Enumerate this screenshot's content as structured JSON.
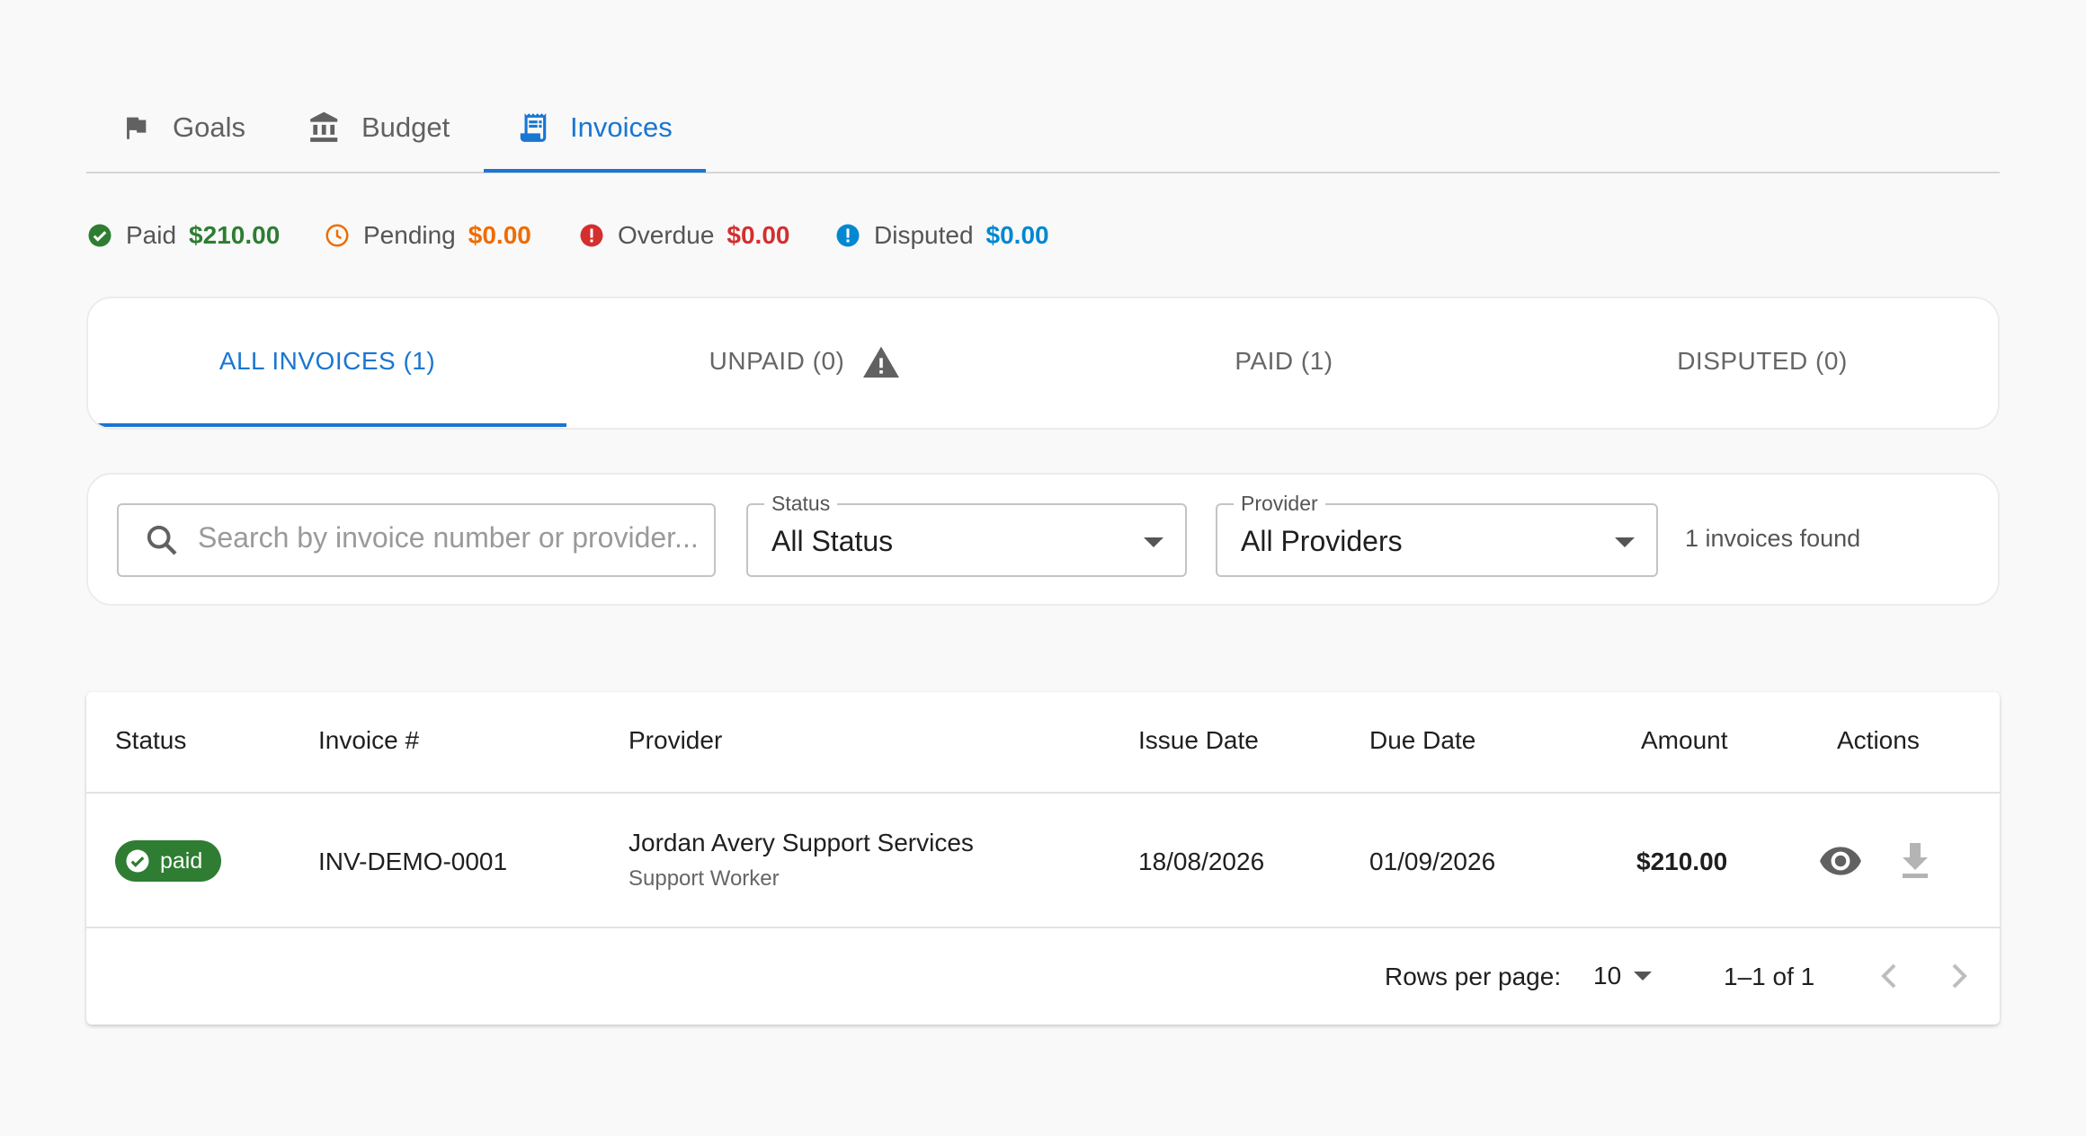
{
  "colors": {
    "accent": "#1976d2",
    "paid": "#2e7d32",
    "pending": "#ef6c00",
    "overdue": "#d32f2f",
    "disputed": "#0288d1"
  },
  "nav": {
    "tabs": [
      {
        "label": "Goals",
        "icon": "flag-icon"
      },
      {
        "label": "Budget",
        "icon": "bank-icon"
      },
      {
        "label": "Invoices",
        "icon": "receipt-icon",
        "active": true
      }
    ]
  },
  "summary": {
    "paid": {
      "label": "Paid",
      "value": "$210.00"
    },
    "pending": {
      "label": "Pending",
      "value": "$0.00"
    },
    "overdue": {
      "label": "Overdue",
      "value": "$0.00"
    },
    "disputed": {
      "label": "Disputed",
      "value": "$0.00"
    }
  },
  "invoice_tabs": [
    {
      "label": "ALL INVOICES (1)",
      "active": true
    },
    {
      "label": "UNPAID (0)",
      "icon": "warning-icon"
    },
    {
      "label": "PAID (1)"
    },
    {
      "label": "DISPUTED (0)"
    }
  ],
  "filters": {
    "search": {
      "placeholder": "Search by invoice number or provider...",
      "value": ""
    },
    "status": {
      "label": "Status",
      "value": "All Status"
    },
    "provider": {
      "label": "Provider",
      "value": "All Providers"
    },
    "results": "1 invoices found"
  },
  "table": {
    "columns": [
      "Status",
      "Invoice #",
      "Provider",
      "Issue Date",
      "Due Date",
      "Amount",
      "Actions"
    ],
    "rows": [
      {
        "status": "paid",
        "invoice_number": "INV-DEMO-0001",
        "provider": "Jordan Avery Support Services",
        "provider_role": "Support Worker",
        "issue_date": "18/08/2026",
        "due_date": "01/09/2026",
        "amount": "$210.00",
        "actions": [
          "view-icon",
          "download-icon"
        ]
      }
    ]
  },
  "pagination": {
    "rows_per_page_label": "Rows per page:",
    "rows_per_page": "10",
    "range": "1–1 of 1"
  }
}
